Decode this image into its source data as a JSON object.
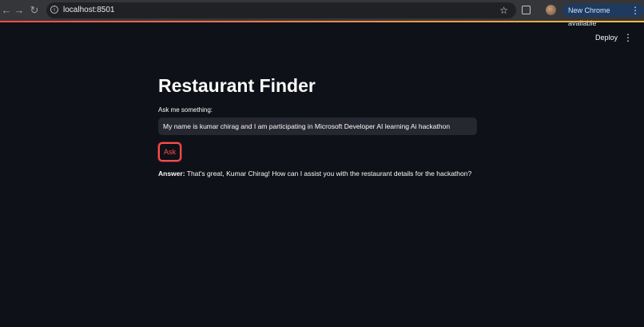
{
  "browser": {
    "url": "localhost:8501",
    "update_chip": "New Chrome available"
  },
  "header": {
    "deploy_label": "Deploy"
  },
  "main": {
    "title": "Restaurant Finder",
    "input_label": "Ask me something:",
    "input_value": "My name is kumar chirag and I am participating in Microsoft Developer AI learning Ai hackathon",
    "ask_label": "Ask",
    "answer_label": "Answer:",
    "answer_text": "That's great, Kumar Chirag! How can I assist you with the restaurant details for the hackathon?"
  },
  "colors": {
    "background": "#0e1117",
    "accent": "#ff4b4b",
    "input_background": "#262730"
  }
}
